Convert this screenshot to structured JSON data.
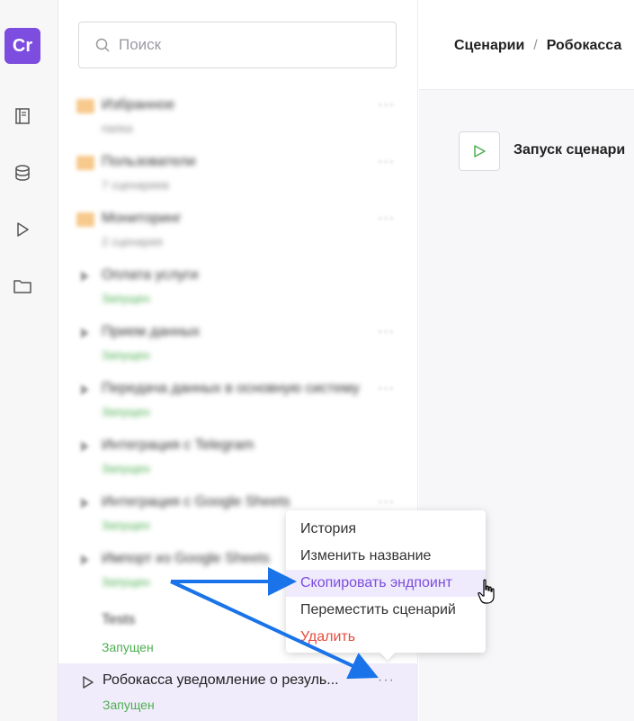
{
  "rail": {
    "logo_text": "Cr",
    "icons": [
      "book-icon",
      "database-icon",
      "play-icon",
      "folder-icon"
    ]
  },
  "search": {
    "placeholder": "Поиск"
  },
  "scenario_list": {
    "blurred_items": [
      {
        "kind": "folder",
        "title": "Избранное",
        "sub": "папка"
      },
      {
        "kind": "folder",
        "title": "Пользователи",
        "sub": "7 сценариев"
      },
      {
        "kind": "folder",
        "title": "Мониторинг",
        "sub": "2 сценария"
      },
      {
        "kind": "scenario",
        "title": "Оплата услуги",
        "sub": "Запущен"
      },
      {
        "kind": "scenario",
        "title": "Прием данных",
        "sub": "Запущен"
      },
      {
        "kind": "scenario",
        "title": "Передача данных в основную систему",
        "sub": "Запущен"
      },
      {
        "kind": "scenario",
        "title": "Интеграция с Telegram",
        "sub": "Запущен"
      },
      {
        "kind": "scenario",
        "title": "Интеграция с Google Sheets",
        "sub": "Запущен"
      },
      {
        "kind": "scenario",
        "title": "Импорт из Google Sheets",
        "sub": "Запущен"
      }
    ],
    "second_last": {
      "title": "Tests",
      "status": "Запущен"
    },
    "active": {
      "title": "Робокасса уведомление о резуль...",
      "status": "Запущен",
      "dots": "···"
    }
  },
  "context_menu": {
    "items": [
      {
        "label": "История",
        "state": "normal"
      },
      {
        "label": "Изменить название",
        "state": "normal"
      },
      {
        "label": "Скопировать эндпоинт",
        "state": "hover"
      },
      {
        "label": "Переместить сценарий",
        "state": "normal"
      },
      {
        "label": "Удалить",
        "state": "danger"
      }
    ]
  },
  "header": {
    "breadcrumb_root": "Сценарии",
    "breadcrumb_sep": "/",
    "breadcrumb_current": "Робокасса"
  },
  "canvas": {
    "start_node_label": "Запуск сценари"
  },
  "colors": {
    "brand": "#7c4dde",
    "success": "#4caf50",
    "danger": "#e74c3c",
    "annotation_arrow": "#1a73e8"
  }
}
